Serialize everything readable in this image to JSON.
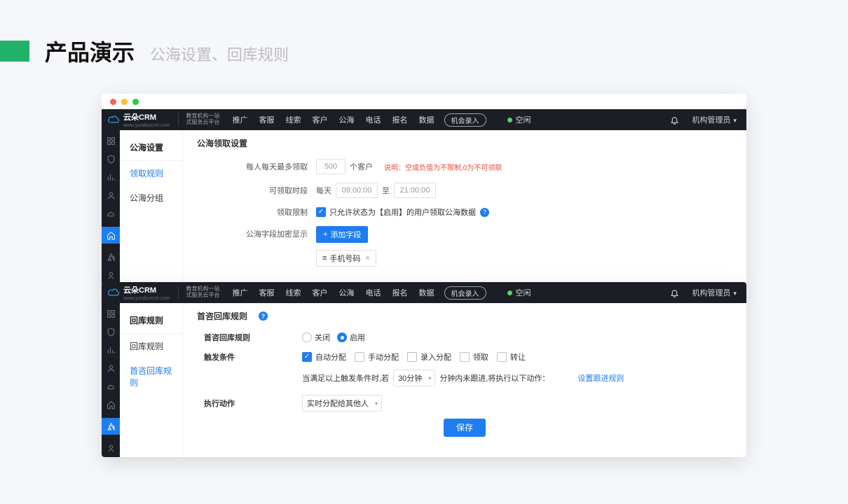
{
  "slide": {
    "title": "产品演示",
    "subtitle": "公海设置、回库规则"
  },
  "common": {
    "logo_text": "云朵CRM",
    "logo_sub1": "教育机构一站",
    "logo_sub2": "式服务云平台",
    "logo_url": "www.yunduocrm.com",
    "nav": [
      "推广",
      "客服",
      "线索",
      "客户",
      "公海",
      "电话",
      "报名",
      "数据"
    ],
    "record_btn": "机会录入",
    "status_text": "空闲",
    "user_role": "机构管理员"
  },
  "shot1": {
    "subnav_title": "公海设置",
    "subnav_items": [
      "领取规则",
      "公海分组"
    ],
    "subnav_active": 0,
    "section_title": "公海领取设置",
    "r1_label": "每人每天最多领取",
    "r1_value": "500",
    "r1_unit": "个客户",
    "r1_tip_prefix": "说明：",
    "r1_tip": "空或负值为不限制,0为不可领取",
    "r2_label": "可领取时段",
    "r2_daily": "每天",
    "r2_from": "09:00:00",
    "r2_to_label": "至",
    "r2_to": "21:00:00",
    "r3_label": "领取限制",
    "r3_text": "只允许状态为【启用】的用户领取公海数据",
    "r4_label": "公海字段加密显示",
    "r4_btn": "添加字段",
    "r4_chip_prefix": "≡",
    "r4_chip": "手机号码"
  },
  "shot2": {
    "subnav_title": "回库规则",
    "subnav_items": [
      "回库规则",
      "首咨回库规则"
    ],
    "subnav_active": 1,
    "section_title": "首咨回库规则",
    "r1_label": "首咨回库规则",
    "opt_off": "关闭",
    "opt_on": "启用",
    "r2_label": "触发条件",
    "c1": "自动分配",
    "c2": "手动分配",
    "c3": "录入分配",
    "c4": "领取",
    "c5": "转让",
    "line2_pre": "当满足以上触发条件时,若",
    "sel_val": "30分钟",
    "line2_mid": "分钟内未跟进,将执行以下动作：",
    "link_txt": "设置跟进规则",
    "r3_label": "执行动作",
    "sel2": "实时分配给其他人",
    "save": "保存"
  }
}
